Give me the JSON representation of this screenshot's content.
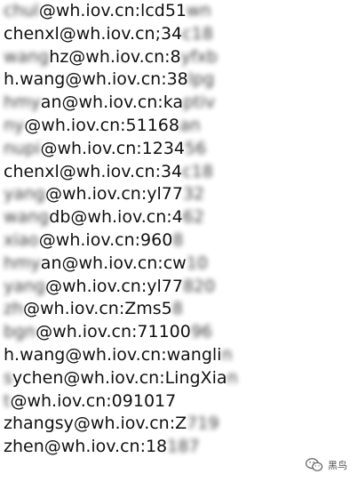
{
  "entries": [
    {
      "left": "chul",
      "mid": "@wh.iov.cn:lcd51",
      "right": "wn"
    },
    {
      "left": "",
      "mid": "chenxl@wh.iov.cn;34",
      "right": "c18"
    },
    {
      "left": "wang",
      "mid": "hz@wh.iov.cn:8",
      "right": "yfxb"
    },
    {
      "left": "",
      "mid": "h.wang@wh.iov.cn:38",
      "right": "lpg"
    },
    {
      "left": "hmy",
      "mid": "an@wh.iov.cn:ka",
      "right": "ptiv"
    },
    {
      "left": "ny",
      "mid": "@wh.iov.cn:51168",
      "right": "an"
    },
    {
      "left": "nupi",
      "mid": "@wh.iov.cn:1234",
      "right": "56"
    },
    {
      "left": "",
      "mid": "chenxl@wh.iov.cn:34",
      "right": "c18"
    },
    {
      "left": "yang",
      "mid": "@wh.iov.cn:yl77",
      "right": "32"
    },
    {
      "left": "wang",
      "mid": "db@wh.iov.cn:4",
      "right": "62"
    },
    {
      "left": "xiao",
      "mid": "@wh.iov.cn:960",
      "right": "8"
    },
    {
      "left": "hmy",
      "mid": "an@wh.iov.cn:cw",
      "right": "10"
    },
    {
      "left": "yang",
      "mid": "@wh.iov.cn:yl77",
      "right": "820"
    },
    {
      "left": "zh",
      "mid": "@wh.iov.cn:Zms5",
      "right": "8"
    },
    {
      "left": "bgn",
      "mid": "@wh.iov.cn:71100",
      "right": "96"
    },
    {
      "left": "",
      "mid": "h.wang@wh.iov.cn:wangli",
      "right": "n"
    },
    {
      "left": "s",
      "mid": "ychen@wh.iov.cn:LingXia",
      "right": "n"
    },
    {
      "left": "t",
      "mid": "@wh.iov.cn:091017",
      "right": ""
    },
    {
      "left": "",
      "mid": "zhangsy@wh.iov.cn:Z",
      "right": "719"
    },
    {
      "left": "",
      "mid": "zhen@wh.iov.cn:18",
      "right": "187"
    }
  ],
  "watermark": {
    "text": "黑鸟",
    "icon": "wechat-logo-icon"
  }
}
